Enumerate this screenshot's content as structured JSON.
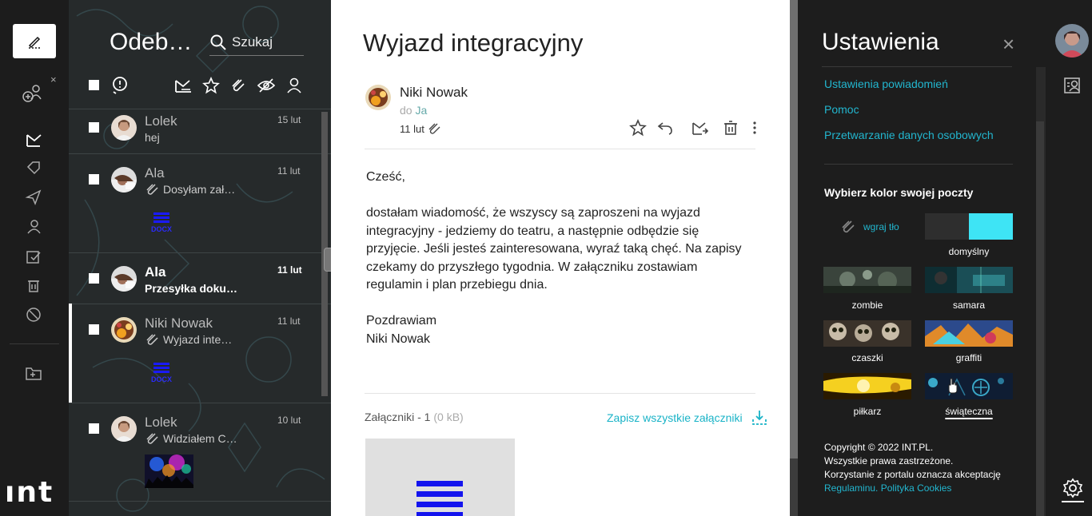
{
  "rail": {
    "logo": "ınt",
    "close": "×"
  },
  "list": {
    "title": "Odeb…",
    "search_label": "Szukaj",
    "rows": [
      {
        "from": "Lolek",
        "subject": "hej",
        "date": "15 lut",
        "unread": false
      },
      {
        "from": "Ala",
        "subject": "Dosyłam zał…",
        "date": "11 lut",
        "unread": false,
        "doc_label": "DOCX"
      },
      {
        "from": "Ala",
        "subject": "Przesyłka doku…",
        "date": "11 lut",
        "unread": true
      },
      {
        "from": "Niki Nowak",
        "subject": "Wyjazd inte…",
        "date": "11 lut",
        "unread": false,
        "doc_label": "DOCX"
      },
      {
        "from": "Lolek",
        "subject": "Widziałem C…",
        "date": "10 lut",
        "unread": false
      }
    ]
  },
  "reader": {
    "subject": "Wyjazd integracyjny",
    "sender": "Niki Nowak",
    "to_prefix": "do",
    "to_name": "Ja",
    "date": "11 lut",
    "greeting": "Cześć,",
    "body": "dostałam wiadomość, że wszyscy są zaproszeni na wyjazd integracyjny - jedziemy do teatru, a następnie odbędzie się przyjęcie. Jeśli jesteś zainteresowana, wyraź taką chęć. Na zapisy czekamy do przyszłego tygodnia. W załączniku zostawiam regulamin i plan przebiegu dnia.",
    "closing": "Pozdrawiam",
    "signature": "Niki Nowak",
    "attachments_label": "Załączniki - 1",
    "attachments_size": "(0 kB)",
    "save_all": "Zapisz wszystkie załączniki"
  },
  "settings": {
    "title": "Ustawienia",
    "close": "×",
    "links": [
      "Ustawienia powiadomień",
      "Pomoc",
      "Przetwarzanie danych osobowych"
    ],
    "color_heading": "Wybierz kolor swojej poczty",
    "upload_label": "wgraj tło",
    "themes": [
      {
        "label": "domyślny",
        "active": false
      },
      {
        "label": "zombie",
        "active": false
      },
      {
        "label": "samara",
        "active": false
      },
      {
        "label": "czaszki",
        "active": false
      },
      {
        "label": "graffiti",
        "active": false
      },
      {
        "label": "piłkarz",
        "active": false
      },
      {
        "label": "świąteczna",
        "active": true
      }
    ],
    "copyright_1": "Copyright © 2022 INT.PL.",
    "copyright_2": "Wszystkie prawa zastrzeżone.",
    "copyright_3": "Korzystanie z portalu oznacza akceptację",
    "terms_link": "Regulaminu.",
    "cookies_link": "Polityka Cookies"
  },
  "colors": {
    "accent": "#22b6cf",
    "default_swatch": "#3ee4f5",
    "doc_blue": "#1414ee"
  }
}
